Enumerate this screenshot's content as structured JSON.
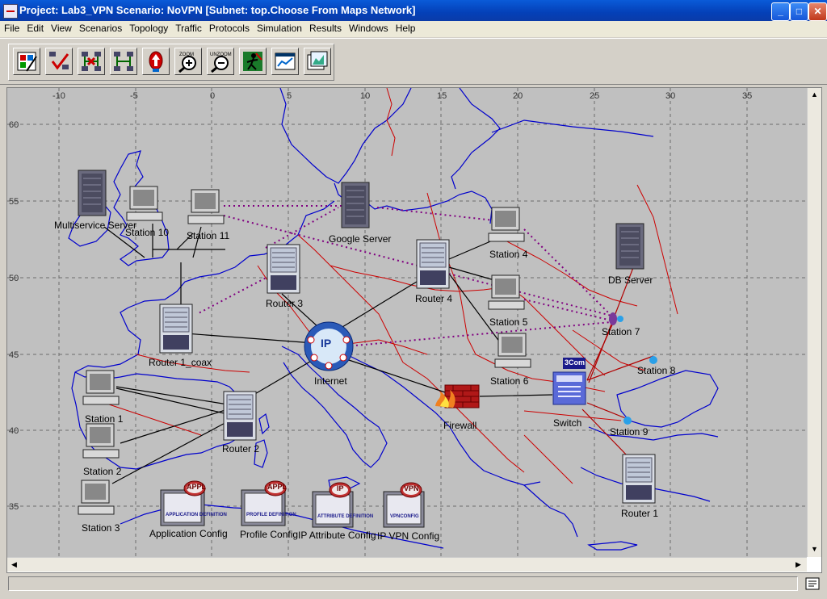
{
  "window": {
    "title": "Project: Lab3_VPN Scenario: NoVPN  [Subnet: top.Choose From Maps Network]",
    "buttons": {
      "minimize": "_",
      "maximize": "□",
      "close": "✕"
    }
  },
  "menu": [
    "File",
    "Edit",
    "View",
    "Scenarios",
    "Topology",
    "Traffic",
    "Protocols",
    "Simulation",
    "Results",
    "Windows",
    "Help"
  ],
  "toolbar": {
    "buttons": [
      {
        "name": "open-object-palette",
        "icon": "palette-icon"
      },
      {
        "name": "verify-links",
        "icon": "check-links-icon"
      },
      {
        "name": "fail-selected-links",
        "icon": "fail-links-icon"
      },
      {
        "name": "recover-selected-links",
        "icon": "recover-links-icon"
      },
      {
        "name": "return-to-parent-subnet",
        "icon": "up-arrow-icon"
      },
      {
        "name": "zoom",
        "icon": "zoom-in-icon",
        "label": "ZOOM"
      },
      {
        "name": "unzoom",
        "icon": "zoom-out-icon",
        "label": "UNZOOM"
      },
      {
        "name": "configure-discrete-event-simulation",
        "icon": "run-simulation-icon"
      },
      {
        "name": "view-simulation-results",
        "icon": "view-results-icon"
      },
      {
        "name": "hide-show-graph-panels",
        "icon": "graph-panels-icon"
      }
    ]
  },
  "map": {
    "lon_ticks": [
      "-10",
      "-5",
      "0",
      "5",
      "10",
      "15",
      "20",
      "25",
      "30",
      "35"
    ],
    "lat_ticks": [
      "60",
      "55",
      "50",
      "45",
      "40",
      "35"
    ],
    "colors": {
      "background": "#c0c0c0",
      "coastline": "#0000cc",
      "borders": "#cc0000",
      "grid": "#6c6c6c",
      "link": "#000000",
      "vpn_link": "#800080"
    }
  },
  "nodes": {
    "multiservice_server": "Multiservice Server",
    "station10": "Station 10",
    "station11": "Station 11",
    "google_server": "Google Server",
    "station4": "Station 4",
    "router3": "Router 3",
    "router4": "Router 4",
    "station5": "Station 5",
    "db_server": "DB Server",
    "station7": "Station 7",
    "router1coax": "Router 1_coax",
    "internet": "Internet",
    "internet_badge": "IP",
    "station6": "Station 6",
    "station8": "Station 8",
    "station1": "Station 1",
    "firewall": "Firewall",
    "switch": "Switch",
    "switch_badge": "3Com",
    "router2": "Router 2",
    "station9": "Station 9",
    "station2": "Station 2",
    "router1": "Router 1",
    "station3": "Station 3",
    "app_config": "Application Config",
    "app_config_badge": "APPL",
    "app_config_inner": "APPLICATION DEFINITION",
    "profile_config": "Profile Config",
    "profile_config_badge": "APPL",
    "profile_config_inner": "PROFILE DEFINITION",
    "ip_attr_config": "IP Attribute Config",
    "ip_attr_badge": "IP",
    "ip_attr_inner": "ATTRIBUTE DEFINITION",
    "ip_vpn_config": "IP VPN Config",
    "ip_vpn_badge": "VPN",
    "ip_vpn_inner": "VPNCONFIG"
  },
  "scroll": {
    "up": "▲",
    "down": "▼",
    "left": "◀",
    "right": "▶"
  }
}
